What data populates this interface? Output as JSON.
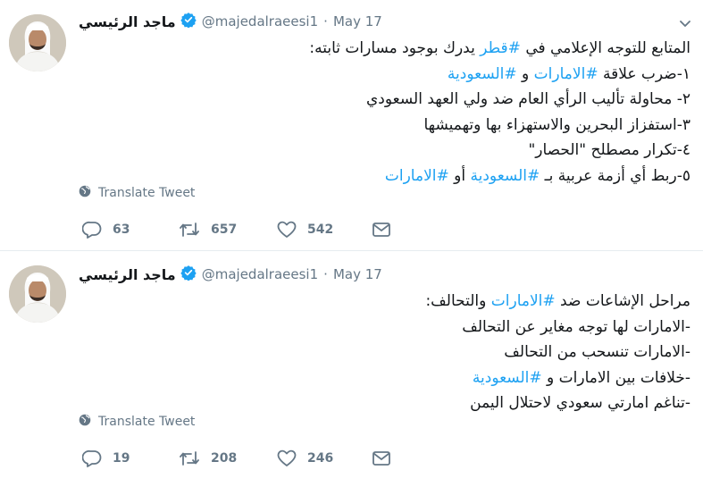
{
  "tweets": [
    {
      "author": {
        "name": "ماجد الرئيسي",
        "handle": "@majedalraeesi1"
      },
      "dot": "·",
      "date": "May 17",
      "lines": [
        {
          "segments": [
            {
              "text": "المتابع للتوجه الإعلامي في ",
              "hashtag": false
            },
            {
              "text": "#قطر",
              "hashtag": true
            },
            {
              "text": " يدرك بوجود مسارات ثابته:",
              "hashtag": false
            }
          ]
        },
        {
          "segments": [
            {
              "text": "١-ضرب علاقة ",
              "hashtag": false
            },
            {
              "text": "#الامارات",
              "hashtag": true
            },
            {
              "text": " و ",
              "hashtag": false
            },
            {
              "text": "#السعودية",
              "hashtag": true
            }
          ]
        },
        {
          "segments": [
            {
              "text": "٢- محاولة تأليب الرأي العام ضد ولي العهد السعودي",
              "hashtag": false
            }
          ]
        },
        {
          "segments": [
            {
              "text": "٣-استفزاز البحرين والاستهزاء بها وتهميشها",
              "hashtag": false
            }
          ]
        },
        {
          "segments": [
            {
              "text": "٤-تكرار مصطلح \"الحصار\"",
              "hashtag": false
            }
          ]
        },
        {
          "segments": [
            {
              "text": "٥-ربط أي أزمة عربية بـ ",
              "hashtag": false
            },
            {
              "text": "#السعودية",
              "hashtag": true
            },
            {
              "text": " أو ",
              "hashtag": false
            },
            {
              "text": "#الامارات",
              "hashtag": true
            }
          ]
        }
      ],
      "translate_label": "Translate Tweet",
      "replies": "63",
      "retweets": "657",
      "likes": "542"
    },
    {
      "author": {
        "name": "ماجد الرئيسي",
        "handle": "@majedalraeesi1"
      },
      "dot": "·",
      "date": "May 17",
      "lines": [
        {
          "segments": [
            {
              "text": "مراحل الإشاعات ضد ",
              "hashtag": false
            },
            {
              "text": "#الامارات",
              "hashtag": true
            },
            {
              "text": " والتحالف:",
              "hashtag": false
            }
          ]
        },
        {
          "segments": [
            {
              "text": "-الامارات لها توجه مغاير عن التحالف",
              "hashtag": false
            }
          ]
        },
        {
          "segments": [
            {
              "text": "-الامارات تنسحب من التحالف",
              "hashtag": false
            }
          ]
        },
        {
          "segments": [
            {
              "text": "-خلافات بين الامارات و ",
              "hashtag": false
            },
            {
              "text": "#السعودية",
              "hashtag": true
            }
          ]
        },
        {
          "segments": [
            {
              "text": "-تناغم امارتي سعودي لاحتلال اليمن",
              "hashtag": false
            }
          ]
        }
      ],
      "translate_label": "Translate Tweet",
      "replies": "19",
      "retweets": "208",
      "likes": "246"
    }
  ],
  "colors": {
    "link": "#1da1f2",
    "muted": "#657786",
    "text": "#14171a",
    "divider": "#e6ecf0"
  },
  "icons": [
    "verified-badge-icon",
    "chevron-down-icon",
    "globe-icon",
    "reply-icon",
    "retweet-icon",
    "like-icon",
    "message-icon"
  ]
}
